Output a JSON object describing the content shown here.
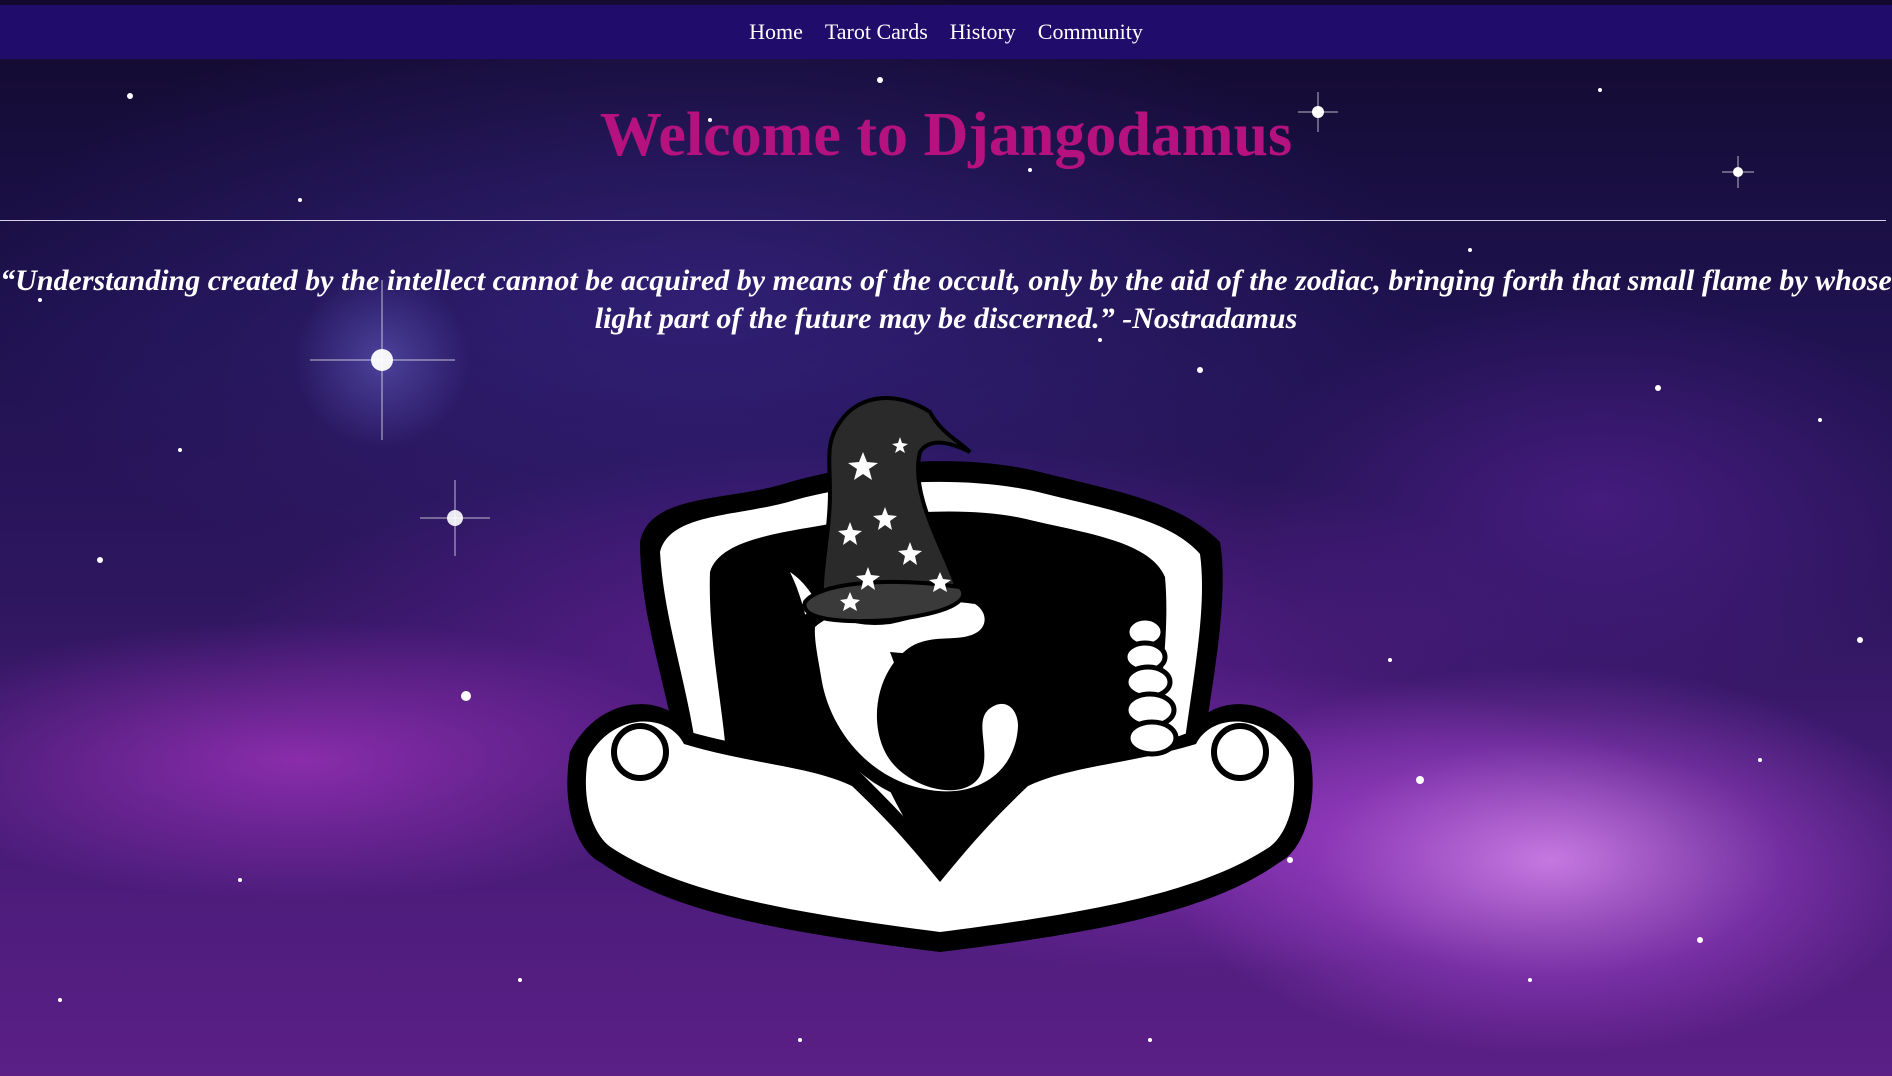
{
  "nav": {
    "items": [
      {
        "label": "Home"
      },
      {
        "label": "Tarot Cards"
      },
      {
        "label": "History"
      },
      {
        "label": "Community"
      }
    ]
  },
  "main": {
    "title": "Welcome to Djangodamus",
    "quote": "“Understanding created by the intellect cannot be acquired by means of the occult, only by the aid of the zodiac, bringing forth that small flame by whose light part of the future may be discerned.” -Nostradamus"
  },
  "logo": {
    "icon": "snake-wizard-hat-logo"
  },
  "colors": {
    "nav_bg": "#1f0c6b",
    "title": "#b5127f",
    "text": "#ffffff"
  }
}
